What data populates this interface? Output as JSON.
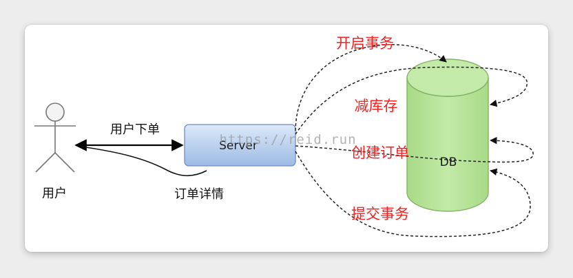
{
  "diagram": {
    "actor": {
      "label": "用户"
    },
    "server": {
      "label": "Server"
    },
    "db": {
      "label": "DB"
    },
    "edges": {
      "request": "用户下单",
      "response": "订单详情"
    },
    "steps": [
      "开启事务",
      "减库存",
      "创建订单",
      "提交事务"
    ],
    "watermark": "https://reid.run",
    "colors": {
      "server_fill_top": "#d7e6f8",
      "server_fill_bottom": "#9fbde6",
      "server_stroke": "#6c8ebf",
      "db_fill": "#b7e39a",
      "db_stroke": "#82b366",
      "step_text": "#f22222"
    }
  }
}
